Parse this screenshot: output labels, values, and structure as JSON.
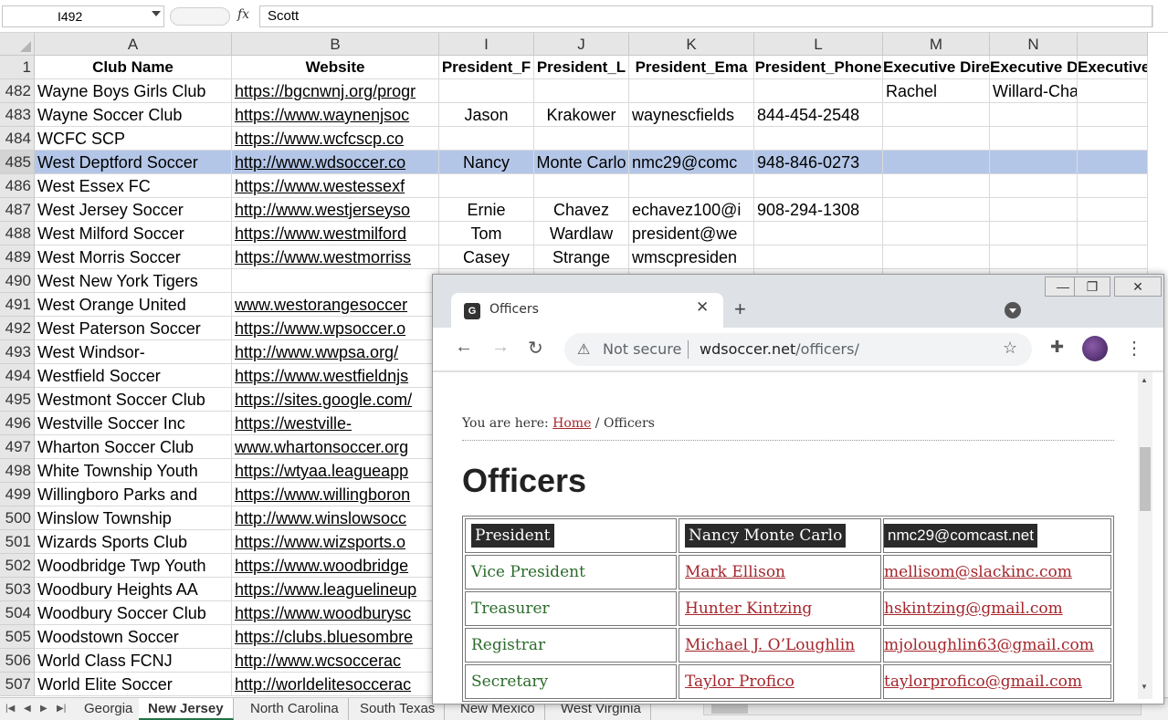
{
  "formula_bar": {
    "name_box": "I492",
    "fx_label": "fx",
    "content": "Scott"
  },
  "spreadsheet": {
    "columns": [
      {
        "letter": "A",
        "header": "Club Name"
      },
      {
        "letter": "B",
        "header": "Website"
      },
      {
        "letter": "I",
        "header": "President_F"
      },
      {
        "letter": "J",
        "header": "President_L"
      },
      {
        "letter": "K",
        "header": "President_Ema"
      },
      {
        "letter": "L",
        "header": "President_Phone"
      },
      {
        "letter": "M",
        "header": "Executive Dire"
      },
      {
        "letter": "N",
        "header": "Executive D"
      },
      {
        "letter": "",
        "header": "Executive"
      }
    ],
    "header_row_num": "1",
    "selected_row": "485",
    "rows": [
      {
        "num": "482",
        "cells": [
          "Wayne Boys Girls Club",
          "https://bgcnwnj.org/progr",
          "",
          "",
          "",
          "",
          "Rachel",
          "Willard-Chang",
          ""
        ]
      },
      {
        "num": "483",
        "cells": [
          "Wayne Soccer Club",
          "https://www.waynenjsoc",
          "Jason",
          "Krakower",
          "waynescfields",
          "844-454-2548",
          "",
          "",
          ""
        ]
      },
      {
        "num": "484",
        "cells": [
          "WCFC SCP",
          "https://www.wcfcscp.co",
          "",
          "",
          "",
          "",
          "",
          "",
          ""
        ]
      },
      {
        "num": "485",
        "cells": [
          "West Deptford Soccer",
          "http://www.wdsoccer.co",
          "Nancy",
          "Monte Carlo",
          "nmc29@comc",
          "948-846-0273",
          "",
          "",
          ""
        ]
      },
      {
        "num": "486",
        "cells": [
          "West Essex FC",
          "https://www.westessexf",
          "",
          "",
          "",
          "",
          "",
          "",
          ""
        ]
      },
      {
        "num": "487",
        "cells": [
          "West Jersey Soccer",
          "http://www.westjerseyso",
          "Ernie",
          "Chavez",
          "echavez100@i",
          "908-294-1308",
          "",
          "",
          ""
        ]
      },
      {
        "num": "488",
        "cells": [
          "West Milford Soccer",
          "https://www.westmilford",
          "Tom",
          "Wardlaw",
          "president@we",
          "",
          "",
          "",
          ""
        ]
      },
      {
        "num": "489",
        "cells": [
          "West Morris Soccer",
          "https://www.westmorriss",
          "Casey",
          "Strange",
          "wmscpresiden",
          "",
          "",
          "",
          ""
        ]
      },
      {
        "num": "490",
        "cells": [
          "West New York Tigers",
          "",
          "",
          "",
          "",
          "",
          "",
          "",
          ""
        ]
      },
      {
        "num": "491",
        "cells": [
          "West Orange United",
          "www.westorangesoccer",
          "",
          "",
          "",
          "",
          "",
          "",
          ""
        ]
      },
      {
        "num": "492",
        "cells": [
          "West Paterson Soccer",
          "https://www.wpsoccer.o",
          "",
          "",
          "",
          "",
          "",
          "",
          ""
        ]
      },
      {
        "num": "493",
        "cells": [
          "West Windsor-",
          "http://www.wwpsa.org/",
          "",
          "",
          "",
          "",
          "",
          "",
          ""
        ]
      },
      {
        "num": "494",
        "cells": [
          "Westfield Soccer",
          "https://www.westfieldnjs",
          "",
          "",
          "",
          "",
          "",
          "",
          ""
        ]
      },
      {
        "num": "495",
        "cells": [
          "Westmont Soccer Club",
          "https://sites.google.com/",
          "",
          "",
          "",
          "",
          "",
          "",
          ""
        ]
      },
      {
        "num": "496",
        "cells": [
          "Westville Soccer Inc",
          "https://westville-",
          "",
          "",
          "",
          "",
          "",
          "",
          ""
        ]
      },
      {
        "num": "497",
        "cells": [
          "Wharton Soccer Club",
          "www.whartonsoccer.org",
          "",
          "",
          "",
          "",
          "",
          "",
          ""
        ]
      },
      {
        "num": "498",
        "cells": [
          "White Township Youth",
          "https://wtyaa.leagueapp",
          "",
          "",
          "",
          "",
          "",
          "",
          ""
        ]
      },
      {
        "num": "499",
        "cells": [
          "Willingboro Parks and",
          "https://www.willingboron",
          "",
          "",
          "",
          "",
          "",
          "",
          ""
        ]
      },
      {
        "num": "500",
        "cells": [
          "Winslow Township",
          "http://www.winslowsocc",
          "",
          "",
          "",
          "",
          "",
          "",
          ""
        ]
      },
      {
        "num": "501",
        "cells": [
          "Wizards Sports Club",
          "https://www.wizsports.o",
          "",
          "",
          "",
          "",
          "",
          "",
          ""
        ]
      },
      {
        "num": "502",
        "cells": [
          "Woodbridge Twp Youth",
          "https://www.woodbridge",
          "",
          "",
          "",
          "",
          "",
          "",
          ""
        ]
      },
      {
        "num": "503",
        "cells": [
          "Woodbury Heights AA",
          "https://www.leaguelineup",
          "",
          "",
          "",
          "",
          "",
          "",
          ""
        ]
      },
      {
        "num": "504",
        "cells": [
          "Woodbury Soccer Club",
          "https://www.woodburysc",
          "",
          "",
          "",
          "",
          "",
          "",
          ""
        ]
      },
      {
        "num": "505",
        "cells": [
          "Woodstown Soccer",
          "https://clubs.bluesombre",
          "",
          "",
          "",
          "",
          "",
          "",
          ""
        ]
      },
      {
        "num": "506",
        "cells": [
          "World Class FCNJ",
          "http://www.wcsoccerac",
          "",
          "",
          "",
          "",
          "",
          "",
          ""
        ]
      },
      {
        "num": "507",
        "cells": [
          "World Elite Soccer",
          "http://worldelitesoccerac",
          "",
          "",
          "",
          "",
          "",
          "",
          ""
        ]
      }
    ]
  },
  "sheet_tabs": [
    "Georgia",
    "New Jersey",
    "North Carolina",
    "South Texas",
    "New Mexico",
    "West Virginia"
  ],
  "active_sheet": "New Jersey",
  "browser": {
    "tab_title": "Officers",
    "favicon_letter": "G",
    "security_label": "Not secure",
    "url_domain": "wdsoccer.net",
    "url_path": "/officers/",
    "page": {
      "breadcrumb_prefix": "You are here: ",
      "breadcrumb_home": "Home",
      "breadcrumb_sep": " / ",
      "breadcrumb_current": "Officers",
      "title": "Officers",
      "officers": [
        {
          "role": "President",
          "name": "Nancy Monte Carlo",
          "email": "nmc29@comcast.net"
        },
        {
          "role": "Vice President",
          "name": "Mark Ellison",
          "email": "mellisom@slackinc.com"
        },
        {
          "role": "Treasurer",
          "name": "Hunter Kintzing",
          "email": "hskintzing@gmail.com"
        },
        {
          "role": "Registrar",
          "name": "Michael J. O’Loughlin",
          "email": "mjoloughlin63@gmail.com"
        },
        {
          "role": "Secretary",
          "name": "Taylor Profico",
          "email": "taylorprofico@gmail.com"
        }
      ]
    }
  }
}
